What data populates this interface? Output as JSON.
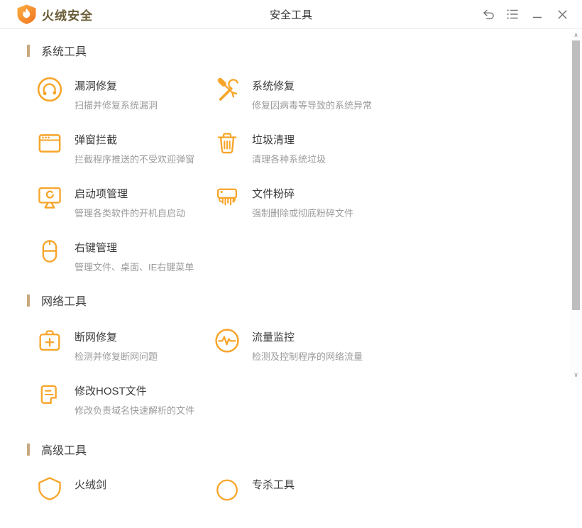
{
  "accent_color": "#F7A52A",
  "section_bar_color": "#C8A87E",
  "window": {
    "brand": "火绒安全",
    "title": "安全工具",
    "controls": [
      {
        "name": "back-icon"
      },
      {
        "name": "menu-icon"
      },
      {
        "name": "minimize-icon"
      },
      {
        "name": "close-icon"
      }
    ]
  },
  "sections": [
    {
      "label": "系统工具",
      "tools": [
        {
          "id": "vulnerability-fix",
          "icon": "vulnerability-scan-icon",
          "title": "漏洞修复",
          "desc": "扫描并修复系统漏洞"
        },
        {
          "id": "system-repair",
          "icon": "repair-tools-icon",
          "title": "系统修复",
          "desc": "修复因病毒等导致的系统异常"
        },
        {
          "id": "popup-blocker",
          "icon": "popup-window-icon",
          "title": "弹窗拦截",
          "desc": "拦截程序推送的不受欢迎弹窗"
        },
        {
          "id": "junk-clean",
          "icon": "trash-icon",
          "title": "垃圾清理",
          "desc": "清理各种系统垃圾"
        },
        {
          "id": "startup-manager",
          "icon": "monitor-startup-icon",
          "title": "启动项管理",
          "desc": "管理各类软件的开机自启动"
        },
        {
          "id": "file-shredder",
          "icon": "shredder-icon",
          "title": "文件粉碎",
          "desc": "强制删除或彻底粉碎文件"
        },
        {
          "id": "context-menu-manager",
          "icon": "mouse-icon",
          "title": "右键管理",
          "desc": "管理文件、桌面、IE右键菜单"
        }
      ]
    },
    {
      "label": "网络工具",
      "tools": [
        {
          "id": "network-repair",
          "icon": "medkit-icon",
          "title": "断网修复",
          "desc": "检测并修复断网问题"
        },
        {
          "id": "traffic-monitor",
          "icon": "pulse-circle-icon",
          "title": "流量监控",
          "desc": "检测及控制程序的网络流量"
        },
        {
          "id": "edit-host-file",
          "icon": "host-document-icon",
          "title": "修改HOST文件",
          "desc": "修改负责域名快速解析的文件"
        }
      ]
    },
    {
      "label": "高级工具",
      "tools": [
        {
          "id": "huorong-sword",
          "icon": "shield-icon",
          "title": "火绒剑"
        },
        {
          "id": "removal-tool",
          "icon": "virus-circle-icon",
          "title": "专杀工具"
        }
      ]
    }
  ],
  "scrollbar": {
    "up_glyph": "∧",
    "down_glyph": "∨"
  }
}
